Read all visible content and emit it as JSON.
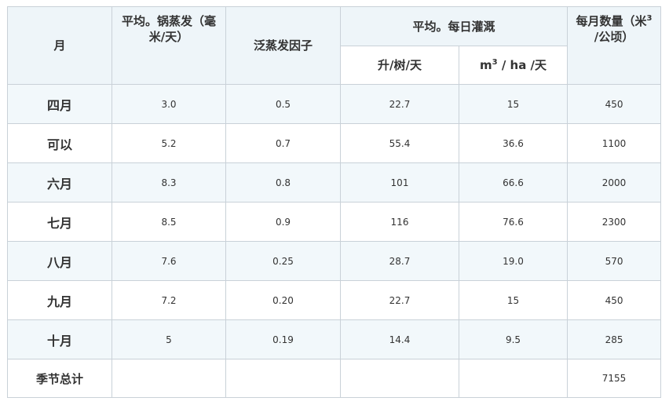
{
  "headers": {
    "month": "月",
    "avg_pan_evap": "平均。锅蒸发（毫米/天）",
    "pan_factor": "泛蒸发因子",
    "avg_daily_irrigation": "平均。每日灌溉",
    "per_tree": "升/树/天",
    "per_ha_prefix": "m",
    "per_ha_sup": "3",
    "per_ha_suffix": "/ ha /天",
    "monthly_amount": "每月数量（米",
    "monthly_amount_sup": "3",
    "monthly_amount_suffix": "/公顷）"
  },
  "rows": [
    {
      "month": "四月",
      "pan_evap": "3.0",
      "factor": "0.5",
      "per_tree": "22.7",
      "per_ha": "15",
      "monthly": "450"
    },
    {
      "month": "可以",
      "pan_evap": "5.2",
      "factor": "0.7",
      "per_tree": "55.4",
      "per_ha": "36.6",
      "monthly": "1100"
    },
    {
      "month": "六月",
      "pan_evap": "8.3",
      "factor": "0.8",
      "per_tree": "101",
      "per_ha": "66.6",
      "monthly": "2000"
    },
    {
      "month": "七月",
      "pan_evap": "8.5",
      "factor": "0.9",
      "per_tree": "116",
      "per_ha": "76.6",
      "monthly": "2300"
    },
    {
      "month": "八月",
      "pan_evap": "7.6",
      "factor": "0.25",
      "per_tree": "28.7",
      "per_ha": "19.0",
      "monthly": "570"
    },
    {
      "month": "九月",
      "pan_evap": "7.2",
      "factor": "0.20",
      "per_tree": "22.7",
      "per_ha": "15",
      "monthly": "450"
    },
    {
      "month": "十月",
      "pan_evap": "5",
      "factor": "0.19",
      "per_tree": "14.4",
      "per_ha": "9.5",
      "monthly": "285"
    }
  ],
  "total": {
    "label": "季节总计",
    "monthly": "7155"
  }
}
